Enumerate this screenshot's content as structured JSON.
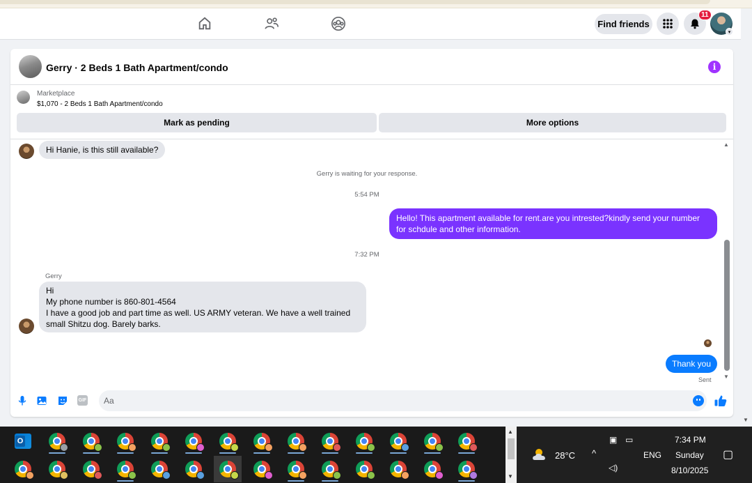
{
  "colors": {
    "outgoing_bubble": "#7a33ff",
    "sent_bubble": "#0a7cff",
    "incoming_bubble": "#e4e6eb",
    "info_icon": "#a033ff",
    "notification_badge": "#e41e3f"
  },
  "topbar": {
    "find_friends_label": "Find friends",
    "notification_count": "11",
    "icons": [
      "home-icon",
      "friends-icon",
      "groups-icon",
      "menu-grid-icon",
      "bell-icon"
    ]
  },
  "chat": {
    "title": "Gerry · 2 Beds 1 Bath Apartment/condo",
    "listing": {
      "label": "Marketplace",
      "price_title": "$1,070 - 2 Beds 1 Bath Apartment/condo",
      "mark_pending_label": "Mark as pending",
      "more_options_label": "More options"
    },
    "messages": {
      "first_incoming": "Hi Hanie, is this still available?",
      "waiting_notice": "Gerry is waiting for your response.",
      "time_1": "5:54 PM",
      "outgoing_line_1": "Hello! This apartment available for rent.are you intrested?kindly send your number",
      "outgoing_line_2": "for schdule and other information.",
      "time_2": "7:32 PM",
      "sender_name": "Gerry",
      "reply_lines": [
        "Hi",
        "My phone number is 860-801-4564",
        "I have a good job and part time as well. US ARMY veteran. We have a well trained",
        "small Shitzu dog. Barely barks."
      ],
      "sent_text": "Thank you",
      "sent_status": "Sent"
    },
    "composer": {
      "placeholder": "Aa",
      "icons": [
        "microphone-icon",
        "photo-icon",
        "sticker-icon",
        "gif-icon",
        "emoji-icon",
        "thumbs-up-icon"
      ]
    }
  },
  "taskbar": {
    "temperature": "28°C",
    "weather_icon": "partly-cloudy-icon",
    "language": "ENG",
    "time": "7:34 PM",
    "day": "Sunday",
    "date": "8/10/2025",
    "row1_badges": [
      "#9aa0a6",
      "#8bc34a",
      "#f4a261",
      "#8bc34a",
      "#e05fd0",
      "#c6d84a",
      "#f4a261",
      "#f4a261",
      "#e05a5a",
      "#8bc34a",
      "#5aa0e0",
      "#8bc34a",
      "#e05a5a"
    ],
    "row2_badges": [
      "#f4a261",
      "#e0c060",
      "#e05a5a",
      "#8bc34a",
      "#5aa0e0",
      "#5aa0e0",
      "#c6d84a",
      "#e05fd0",
      "#f4a261",
      "#8bc34a",
      "#8bc34a",
      "#f4a261",
      "#e05fd0",
      "#b07ae0"
    ]
  }
}
